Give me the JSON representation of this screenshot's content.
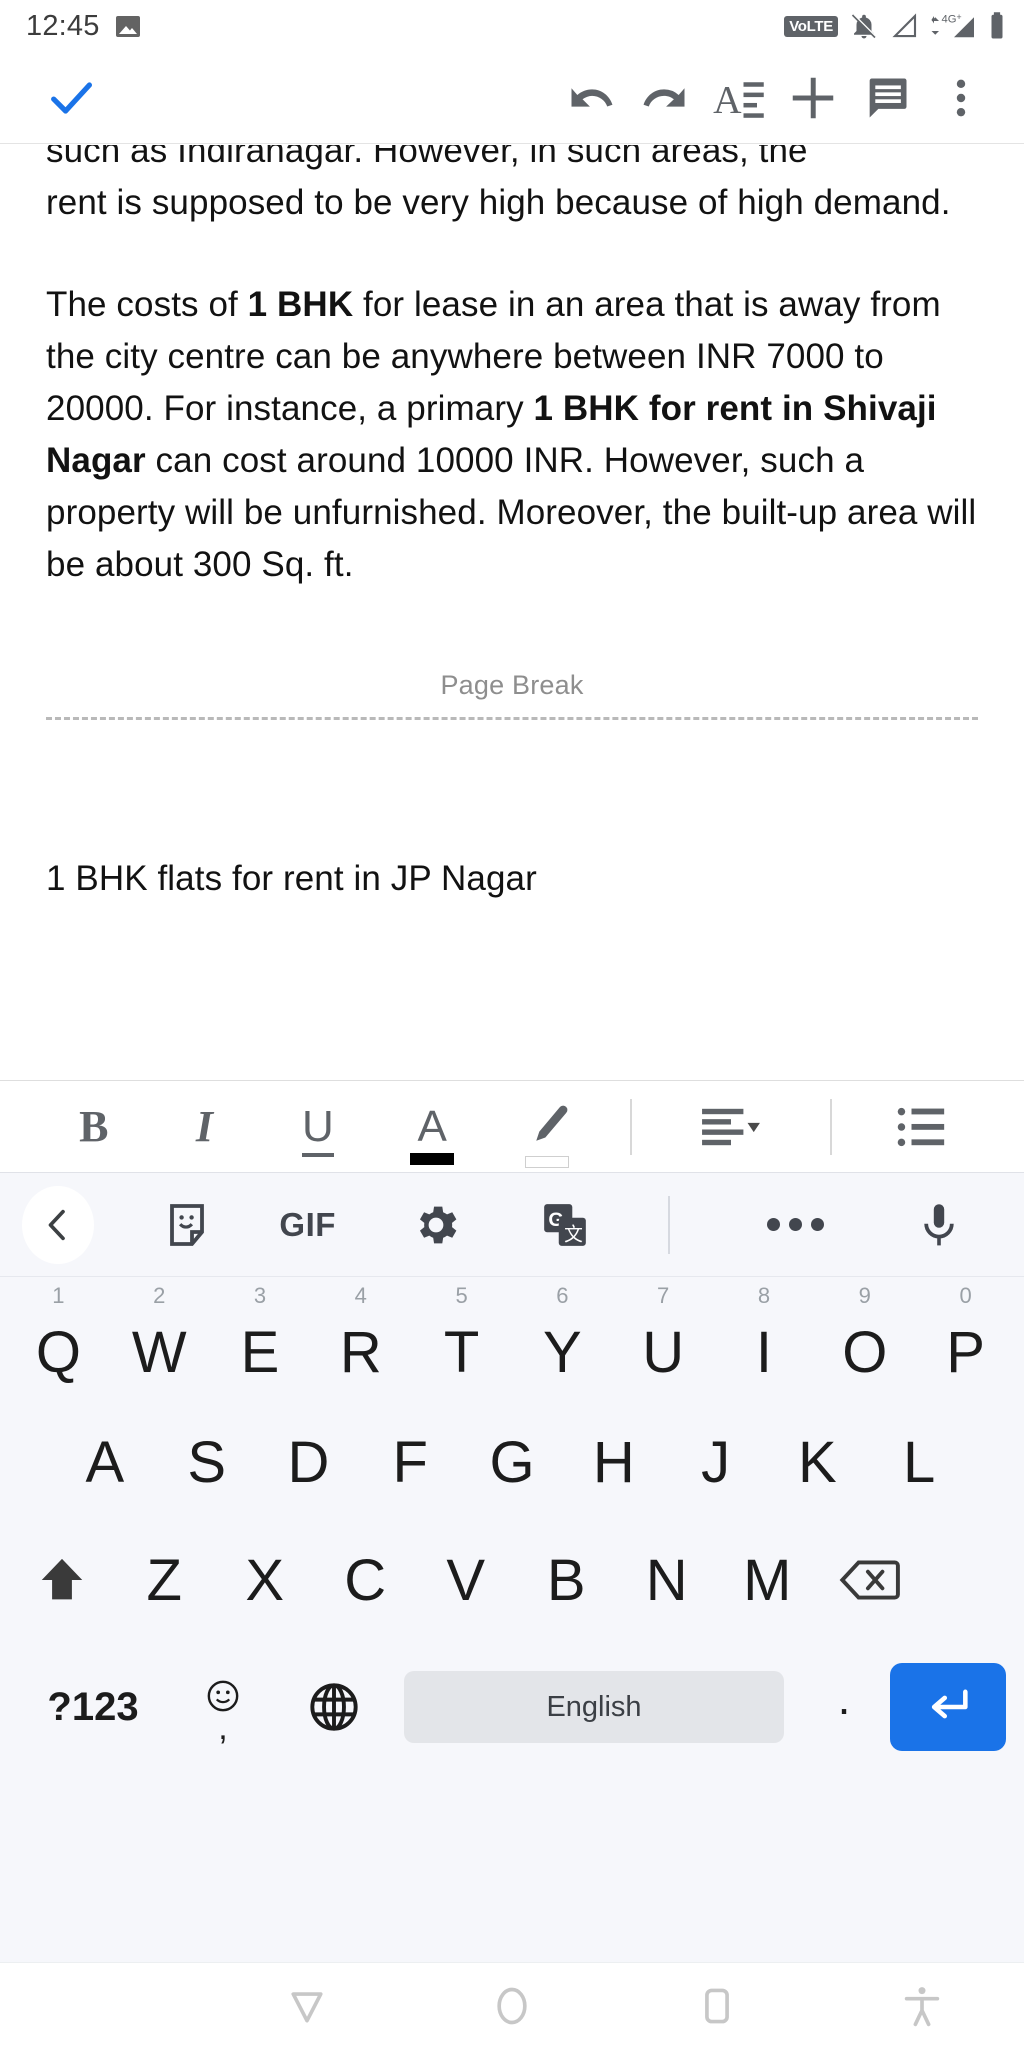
{
  "status_bar": {
    "clock": "12:45",
    "left_icons": [
      "image-icon"
    ],
    "right_icons": [
      "volte-badge",
      "bell-off-icon",
      "signal-1-icon",
      "signal-4g-icon",
      "battery-icon"
    ],
    "volte_label": "VoLTE",
    "network_label": "4G+"
  },
  "app_bar": {
    "accept_label": "done-check",
    "items": [
      {
        "name": "undo-button",
        "icon": "undo-icon"
      },
      {
        "name": "redo-button",
        "icon": "redo-icon"
      },
      {
        "name": "format-button",
        "icon": "text-format-icon"
      },
      {
        "name": "insert-button",
        "icon": "plus-icon"
      },
      {
        "name": "comment-button",
        "icon": "comment-icon"
      },
      {
        "name": "more-options-button",
        "icon": "overflow-menu-icon"
      }
    ]
  },
  "document": {
    "clipped_top_line": "such as Indiranagar. However, in such areas, the",
    "paragraph1_rest": "rent is supposed to be very high because of high demand.",
    "paragraph2": {
      "segments": [
        {
          "text": "The costs of ",
          "bold": false
        },
        {
          "text": "1 BHK",
          "bold": true
        },
        {
          "text": " for lease in an area that is away from the city centre can be anywhere between INR 7000 to 20000. For instance, a primary ",
          "bold": false
        },
        {
          "text": "1 BHK for rent in Shivaji Nagar",
          "bold": true
        },
        {
          "text": " can cost around 10000 INR. However, such a property will be unfurnished. Moreover, the built-up area will be about 300 Sq. ft.",
          "bold": false
        }
      ]
    },
    "page_break_label": "Page Break",
    "next_heading": "1 BHK flats for rent in JP Nagar"
  },
  "format_toolbar": {
    "items": [
      {
        "name": "bold-button",
        "label": "B",
        "icon": "bold-icon"
      },
      {
        "name": "italic-button",
        "label": "I",
        "icon": "italic-icon"
      },
      {
        "name": "underline-button",
        "label": "U",
        "icon": "underline-icon"
      },
      {
        "name": "text-color-button",
        "label": "A",
        "icon": "text-color-icon",
        "color": "#000000"
      },
      {
        "name": "highlight-color-button",
        "label": "",
        "icon": "highlighter-icon",
        "color": "#ffffff"
      },
      {
        "name": "align-button",
        "label": "",
        "icon": "align-left-icon"
      },
      {
        "name": "list-button",
        "label": "",
        "icon": "bulleted-list-icon"
      }
    ]
  },
  "keyboard": {
    "toolbar": [
      {
        "name": "collapse-toolbar-button",
        "icon": "chevron-left-icon"
      },
      {
        "name": "sticker-button",
        "icon": "sticker-icon"
      },
      {
        "name": "gif-button",
        "icon": "gif-icon",
        "label": "GIF"
      },
      {
        "name": "settings-button",
        "icon": "gear-icon"
      },
      {
        "name": "translate-button",
        "icon": "google-translate-icon"
      },
      {
        "name": "more-button",
        "icon": "three-dots-icon"
      },
      {
        "name": "voice-input-button",
        "icon": "microphone-icon"
      }
    ],
    "row1": [
      {
        "key": "Q",
        "num": "1"
      },
      {
        "key": "W",
        "num": "2"
      },
      {
        "key": "E",
        "num": "3"
      },
      {
        "key": "R",
        "num": "4"
      },
      {
        "key": "T",
        "num": "5"
      },
      {
        "key": "Y",
        "num": "6"
      },
      {
        "key": "U",
        "num": "7"
      },
      {
        "key": "I",
        "num": "8"
      },
      {
        "key": "O",
        "num": "9"
      },
      {
        "key": "P",
        "num": "0"
      }
    ],
    "row2": [
      "A",
      "S",
      "D",
      "F",
      "G",
      "H",
      "J",
      "K",
      "L"
    ],
    "row3": [
      "Z",
      "X",
      "C",
      "V",
      "B",
      "N",
      "M"
    ],
    "shift_icon": "shift-up-arrow-icon",
    "delete_icon": "backspace-icon",
    "symbols_label": "?123",
    "emoji_icon": "emoji-smiley-icon",
    "comma_label": ",",
    "globe_icon": "globe-language-icon",
    "space_label": "English",
    "period_label": ".",
    "enter_icon": "enter-return-icon",
    "enter_color": "#1a73e8"
  },
  "nav_bar": [
    {
      "name": "nav-back-button",
      "icon": "back-triangle-icon"
    },
    {
      "name": "nav-home-button",
      "icon": "home-circle-icon"
    },
    {
      "name": "nav-recents-button",
      "icon": "recents-square-icon"
    },
    {
      "name": "nav-accessibility-button",
      "icon": "accessibility-icon"
    }
  ]
}
